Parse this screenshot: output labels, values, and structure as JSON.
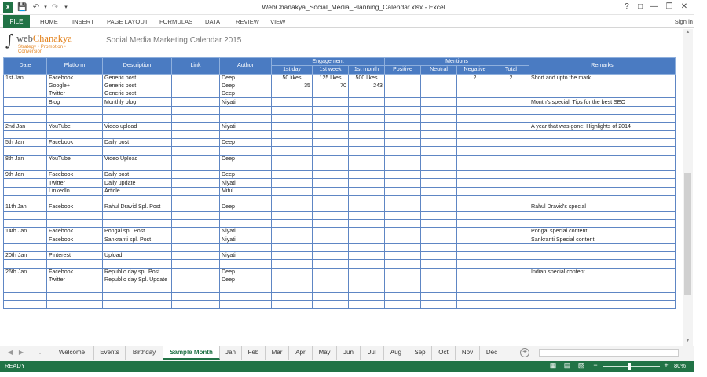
{
  "window": {
    "title": "WebChanakya_Social_Media_Planning_Calendar.xlsx - Excel",
    "help": "?",
    "minimize": "—",
    "restore": "❐",
    "close": "✕"
  },
  "ribbon": {
    "tabs": [
      "FILE",
      "HOME",
      "INSERT",
      "PAGE LAYOUT",
      "FORMULAS",
      "DATA",
      "REVIEW",
      "VIEW"
    ],
    "sign_in": "Sign in"
  },
  "logo": {
    "brand_prefix": "web",
    "brand_name": "Chanakya",
    "tagline": "Strategy • Promotion • Conversion"
  },
  "sheet_title": "Social Media Marketing Calendar 2015",
  "table": {
    "headers": {
      "date": "Date",
      "platform": "Platform",
      "description": "Description",
      "link": "Link",
      "author": "Author",
      "engagement": "Engagement",
      "mentions": "Mentions",
      "remarks": "Remarks"
    },
    "subheaders": [
      "1st day",
      "1st week",
      "1st month",
      "Positive",
      "Neutral",
      "Negative",
      "Total"
    ],
    "rows": [
      [
        "1st Jan",
        "Facebook",
        "Generic post",
        "",
        "Deep",
        "50 likes",
        "125 likes",
        "500 likes",
        "",
        "",
        "2",
        "2",
        "Short and upto the mark"
      ],
      [
        "",
        "Google+",
        "Generic post",
        "",
        "Deep",
        "35",
        "70",
        "243",
        "",
        "",
        "",
        "",
        ""
      ],
      [
        "",
        "Twitter",
        "Generic post",
        "",
        "Deep",
        "",
        "",
        "",
        "",
        "",
        "",
        "",
        ""
      ],
      [
        "",
        "Blog",
        "Monthly blog",
        "",
        "Niyati",
        "",
        "",
        "",
        "",
        "",
        "",
        "",
        "Month's special: Tips for the best SEO"
      ],
      [
        "",
        "",
        "",
        "",
        "",
        "",
        "",
        "",
        "",
        "",
        "",
        "",
        ""
      ],
      [
        "",
        "",
        "",
        "",
        "",
        "",
        "",
        "",
        "",
        "",
        "",
        "",
        ""
      ],
      [
        "2nd Jan",
        "YouTube",
        "Video upload",
        "",
        "Niyati",
        "",
        "",
        "",
        "",
        "",
        "",
        "",
        "A year that was gone: Highlights of 2014"
      ],
      [
        "",
        "",
        "",
        "",
        "",
        "",
        "",
        "",
        "",
        "",
        "",
        "",
        ""
      ],
      [
        "5th Jan",
        "Facebook",
        "Daily post",
        "",
        "Deep",
        "",
        "",
        "",
        "",
        "",
        "",
        "",
        ""
      ],
      [
        "",
        "",
        "",
        "",
        "",
        "",
        "",
        "",
        "",
        "",
        "",
        "",
        ""
      ],
      [
        "8th Jan",
        "YouTube",
        "Video Upload",
        "",
        "Deep",
        "",
        "",
        "",
        "",
        "",
        "",
        "",
        ""
      ],
      [
        "",
        "",
        "",
        "",
        "",
        "",
        "",
        "",
        "",
        "",
        "",
        "",
        ""
      ],
      [
        "9th Jan",
        "Facebook",
        "Daily post",
        "",
        "Deep",
        "",
        "",
        "",
        "",
        "",
        "",
        "",
        ""
      ],
      [
        "",
        "Twitter",
        "Daily update",
        "",
        "Niyati",
        "",
        "",
        "",
        "",
        "",
        "",
        "",
        ""
      ],
      [
        "",
        "LinkedIn",
        "Article",
        "",
        "Mitul",
        "",
        "",
        "",
        "",
        "",
        "",
        "",
        ""
      ],
      [
        "",
        "",
        "",
        "",
        "",
        "",
        "",
        "",
        "",
        "",
        "",
        "",
        ""
      ],
      [
        "11th Jan",
        "Facebook",
        "Rahul Dravid Spl. Post",
        "",
        "Deep",
        "",
        "",
        "",
        "",
        "",
        "",
        "",
        "Rahul Dravid's special"
      ],
      [
        "",
        "",
        "",
        "",
        "",
        "",
        "",
        "",
        "",
        "",
        "",
        "",
        ""
      ],
      [
        "",
        "",
        "",
        "",
        "",
        "",
        "",
        "",
        "",
        "",
        "",
        "",
        ""
      ],
      [
        "14th Jan",
        "Facebook",
        "Pongal spl. Post",
        "",
        "Niyati",
        "",
        "",
        "",
        "",
        "",
        "",
        "",
        "Pongal special content"
      ],
      [
        "",
        "Facebook",
        "Sankranti spl. Post",
        "",
        "Niyati",
        "",
        "",
        "",
        "",
        "",
        "",
        "",
        "Sankranti Special content"
      ],
      [
        "",
        "",
        "",
        "",
        "",
        "",
        "",
        "",
        "",
        "",
        "",
        "",
        ""
      ],
      [
        "20th Jan",
        "Pinterest",
        "Upload",
        "",
        "Niyati",
        "",
        "",
        "",
        "",
        "",
        "",
        "",
        ""
      ],
      [
        "",
        "",
        "",
        "",
        "",
        "",
        "",
        "",
        "",
        "",
        "",
        "",
        ""
      ],
      [
        "26th Jan",
        "Facebook",
        "Republic day spl. Post",
        "",
        "Deep",
        "",
        "",
        "",
        "",
        "",
        "",
        "",
        "Indian special content"
      ],
      [
        "",
        "Twitter",
        "Republic day Spl. Update",
        "",
        "Deep",
        "",
        "",
        "",
        "",
        "",
        "",
        "",
        ""
      ],
      [
        "",
        "",
        "",
        "",
        "",
        "",
        "",
        "",
        "",
        "",
        "",
        "",
        ""
      ],
      [
        "",
        "",
        "",
        "",
        "",
        "",
        "",
        "",
        "",
        "",
        "",
        "",
        ""
      ],
      [
        "",
        "",
        "",
        "",
        "",
        "",
        "",
        "",
        "",
        "",
        "",
        "",
        ""
      ]
    ]
  },
  "sheet_tabs": [
    "Welcome",
    "Events",
    "Birthday",
    "Sample Month",
    "Jan",
    "Feb",
    "Mar",
    "Apr",
    "May",
    "Jun",
    "Jul",
    "Aug",
    "Sep",
    "Oct",
    "Nov",
    "Dec"
  ],
  "active_sheet": "Sample Month",
  "status": {
    "ready": "READY",
    "zoom": "80%"
  },
  "colors": {
    "excel_green": "#217346",
    "header_blue": "#4a7bc2",
    "grid_blue": "#5e86c4",
    "brand_orange": "#e48420"
  }
}
